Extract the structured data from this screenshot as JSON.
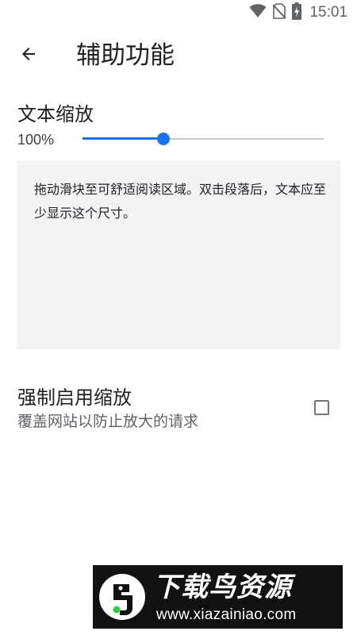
{
  "status_bar": {
    "time": "15:01",
    "icons": [
      "wifi-icon",
      "no-sim-icon",
      "battery-charging-icon"
    ]
  },
  "app_bar": {
    "back_icon": "arrow-back-icon",
    "title": "辅助功能"
  },
  "text_scaling": {
    "title": "文本缩放",
    "value_label": "100%",
    "slider_fraction": 0.335,
    "accent_color": "#1a73e8"
  },
  "preview": {
    "text": "拖动滑块至可舒适阅读区域。双击段落后，文本应至少显示这个尺寸。"
  },
  "force_zoom": {
    "title": "强制启用缩放",
    "summary": "覆盖网站以防止放大的请求",
    "checked": false
  },
  "watermark": {
    "title": "下载鸟资源",
    "url": "www.xiazainiao.com"
  }
}
